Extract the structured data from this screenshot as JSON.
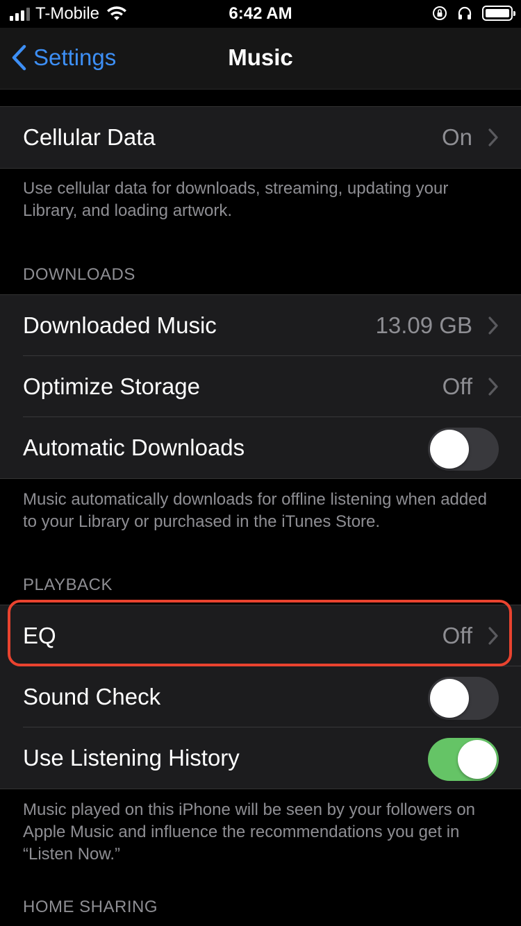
{
  "status_bar": {
    "carrier": "T-Mobile",
    "time": "6:42 AM"
  },
  "nav": {
    "back_label": "Settings",
    "title": "Music"
  },
  "cellular": {
    "label": "Cellular Data",
    "value": "On",
    "footer": "Use cellular data for downloads, streaming, updating your Library, and loading artwork."
  },
  "downloads": {
    "header": "DOWNLOADS",
    "downloaded_music": {
      "label": "Downloaded Music",
      "value": "13.09 GB"
    },
    "optimize_storage": {
      "label": "Optimize Storage",
      "value": "Off"
    },
    "automatic_downloads": {
      "label": "Automatic Downloads",
      "on": false
    },
    "footer": "Music automatically downloads for offline listening when added to your Library or purchased in the iTunes Store."
  },
  "playback": {
    "header": "PLAYBACK",
    "eq": {
      "label": "EQ",
      "value": "Off"
    },
    "sound_check": {
      "label": "Sound Check",
      "on": false
    },
    "listening_history": {
      "label": "Use Listening History",
      "on": true
    },
    "footer": "Music played on this iPhone will be seen by your followers on Apple Music and influence the recommendations you get in “Listen Now.”"
  },
  "home_sharing": {
    "header": "HOME SHARING"
  },
  "colors": {
    "accent": "#3d8ff5",
    "toggle_on": "#65c466",
    "highlight": "#e9432f"
  }
}
